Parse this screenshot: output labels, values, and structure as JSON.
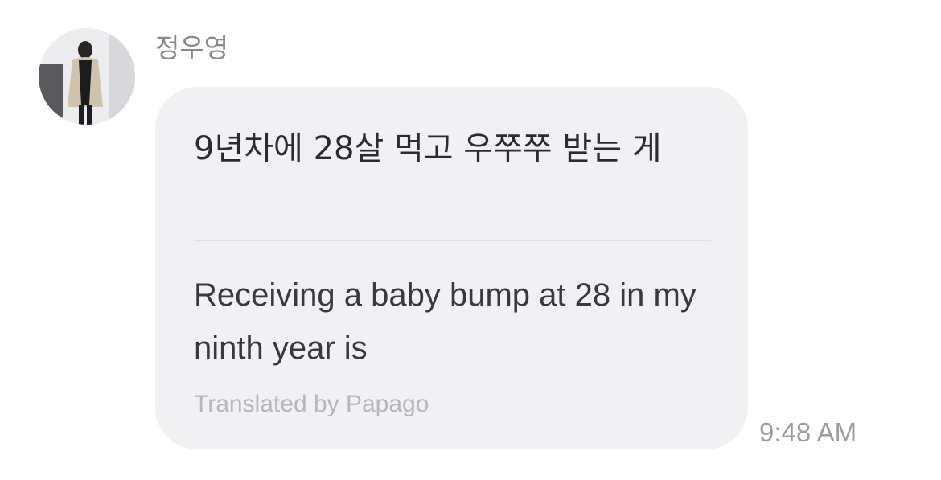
{
  "message": {
    "sender_name": "정우영",
    "original_text": "9년차에 28살 먹고 우쭈쭈 받는 게",
    "translated_text": "Receiving a baby bump at 28 in my ninth year is",
    "translated_by": "Translated by Papago",
    "timestamp": "9:48 AM"
  },
  "colors": {
    "bubble_background": "#f1f1f4",
    "sender_name": "#8a8a8e",
    "message_text": "#2c2c2e",
    "translation_credit": "#b7b7bd",
    "timestamp": "#9b9ba0"
  },
  "icons": {
    "avatar": "profile-photo"
  }
}
